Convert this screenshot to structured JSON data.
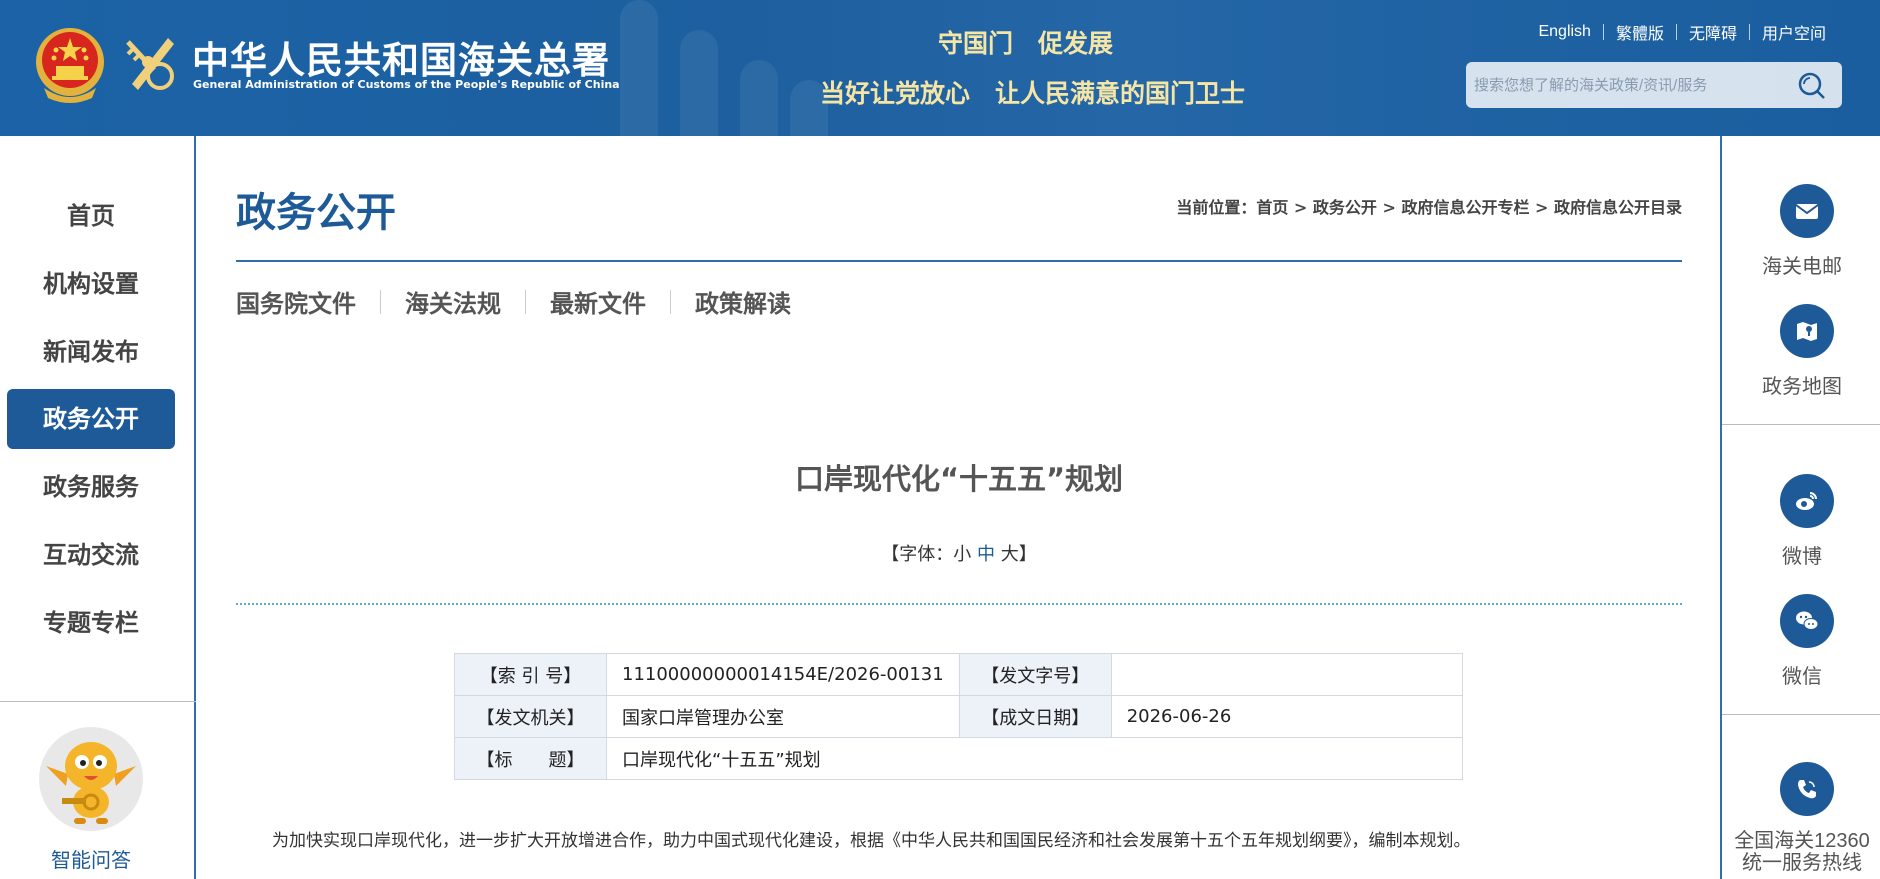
{
  "header": {
    "logo_cn": "中华人民共和国海关总署",
    "logo_en": "General Administration of Customs of the People's Republic of China",
    "slogan_line1": "守国门　促发展",
    "slogan_line2": "当好让党放心　让人民满意的国门卫士",
    "top_links": [
      "English",
      "繁體版",
      "无障碍",
      "用户空间"
    ],
    "search": {
      "placeholder": "搜索您想了解的海关政策/资讯/服务"
    }
  },
  "left_nav": {
    "items": [
      "首页",
      "机构设置",
      "新闻发布",
      "政务公开",
      "政务服务",
      "互动交流",
      "专题专栏"
    ],
    "active": "政务公开",
    "assistant_label": "智能问答"
  },
  "right_bar": {
    "email_label": "海关电邮",
    "map_label": "政务地图",
    "weibo_label": "微博",
    "wechat_label": "微信",
    "hotline_line1": "全国海关12360",
    "hotline_line2": "统一服务热线"
  },
  "main": {
    "section_title": "政务公开",
    "breadcrumb": "当前位置：首页 > 政务公开 > 政府信息公开专栏 > 政府信息公开目录",
    "subtabs": [
      "国务院文件",
      "海关法规",
      "最新文件",
      "政策解读"
    ],
    "doc_title": "口岸现代化“十五五”规划",
    "font_size": {
      "prefix": "【字体：",
      "small": "小",
      "medium": "中",
      "large": "大",
      "suffix": "】"
    },
    "info_table": {
      "index_label": "【索 引 号】",
      "index_value": "11100000000014154E/2026-00131",
      "docno_label": "【发文字号】",
      "docno_value": "",
      "issuer_label": "【发文机关】",
      "issuer_value": "国家口岸管理办公室",
      "date_label": "【成文日期】",
      "date_value": "2026-06-26",
      "title_label": "【标　　题】",
      "title_value": "口岸现代化“十五五”规划"
    },
    "paragraph": "为加快实现口岸现代化，进一步扩大开放增进合作，助力中国式现代化建设，根据《中华人民共和国国民经济和社会发展第十五个五年规划纲要》，编制本规划。"
  },
  "colors": {
    "primary": "#1d5a97",
    "header_bg": "#1b63a6",
    "slogan": "#f6e6a6"
  }
}
